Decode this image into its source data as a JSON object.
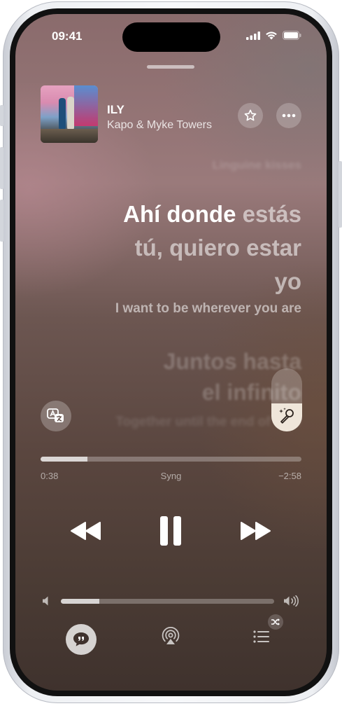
{
  "status_bar": {
    "time": "09:41"
  },
  "now_playing": {
    "title": "ILY",
    "artist": "Kapo & Myke Towers",
    "favorite_icon": "star-icon",
    "more_icon": "ellipsis-icon"
  },
  "lyrics": {
    "previous_line": "Linguine kisses",
    "current_line_sung_1": "Ahí donde",
    "current_line_unsung_1": "estás",
    "current_line_unsung_2": "tú, quiero estar",
    "current_line_unsung_3": "yo",
    "current_translation": "I want to be wherever you are",
    "next_line_1": "Juntos hasta",
    "next_line_2": "el infinito",
    "next_translation": "Together until the end of time"
  },
  "sing": {
    "vocal_level": 0.45
  },
  "playback": {
    "elapsed": "0:38",
    "remaining": "−2:58",
    "mode_label": "Syng",
    "progress": 0.18
  },
  "volume": {
    "level": 0.18
  },
  "colors": {
    "accent": "#efe6da",
    "background": "#6c5651"
  }
}
